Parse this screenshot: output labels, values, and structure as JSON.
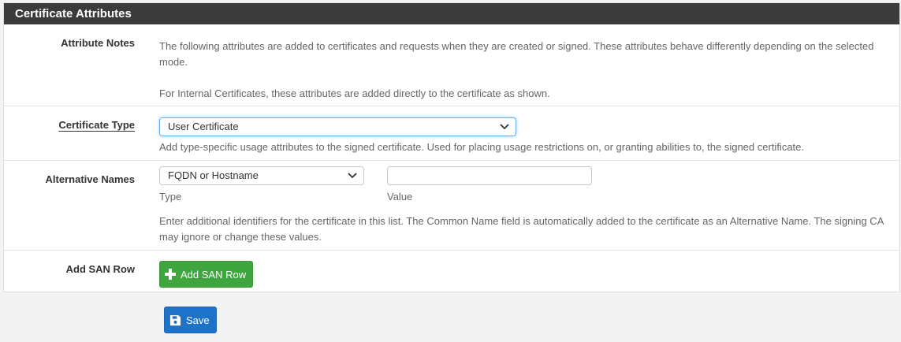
{
  "panel": {
    "title": "Certificate Attributes"
  },
  "attribute_notes": {
    "label": "Attribute Notes",
    "text_1": "The following attributes are added to certificates and requests when they are created or signed. These attributes behave differently depending on the selected mode.",
    "text_2": "For Internal Certificates, these attributes are added directly to the certificate as shown."
  },
  "certificate_type": {
    "label": "Certificate Type",
    "selected": "User Certificate",
    "help": "Add type-specific usage attributes to the signed certificate. Used for placing usage restrictions on, or granting abilities to, the signed certificate."
  },
  "alternative_names": {
    "label": "Alternative Names",
    "type_selected": "FQDN or Hostname",
    "type_label": "Type",
    "value": "",
    "value_label": "Value",
    "help": "Enter additional identifiers for the certificate in this list. The Common Name field is automatically added to the certificate as an Alternative Name. The signing CA may ignore or change these values."
  },
  "add_san_row": {
    "label": "Add SAN Row",
    "button_label": "Add SAN Row"
  },
  "save_label": "Save",
  "icons": {
    "add": "plus-icon",
    "save": "floppy-disk-icon",
    "dropdown": "chevron-down-icon"
  },
  "colors": {
    "header_bg": "#3b3b3b",
    "success": "#3fa63f",
    "primary": "#1e73c8"
  }
}
